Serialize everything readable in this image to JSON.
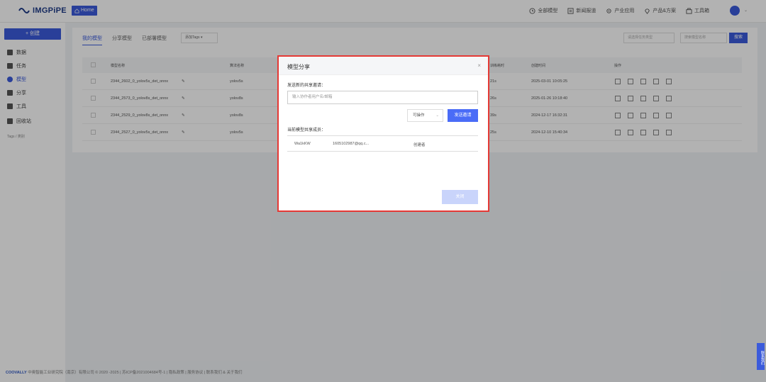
{
  "header": {
    "logo_text": "IMGPiPE",
    "home_label": "Home",
    "nav": [
      {
        "label": "全部模型",
        "icon": "clock-icon"
      },
      {
        "label": "新闻报道",
        "icon": "news-icon"
      },
      {
        "label": "产业应用",
        "icon": "gear-icon"
      },
      {
        "label": "产品&方案",
        "icon": "location-icon"
      },
      {
        "label": "工具箱",
        "icon": "toolbox-icon"
      }
    ]
  },
  "sidebar": {
    "create_label": "+ 创建",
    "items": [
      {
        "label": "数据",
        "active": false
      },
      {
        "label": "任务",
        "active": false
      },
      {
        "label": "模型",
        "active": true
      },
      {
        "label": "分享",
        "active": false
      },
      {
        "label": "工具",
        "active": false
      },
      {
        "label": "回收站",
        "active": false
      }
    ],
    "tags_label": "Tags / 类别"
  },
  "main": {
    "tabs": [
      "我的模型",
      "分享模型",
      "已部署模型"
    ],
    "tag_select": "添加Tags",
    "filter_placeholder": "请选择任务类型",
    "search_placeholder": "搜索模型名称",
    "search_label": "搜索",
    "columns": [
      "模型名称",
      "算法名称",
      "训练耗时",
      "创建时间",
      "操作"
    ],
    "rows": [
      {
        "name": "2344_2602_0_yolov5s_det_onnx",
        "algo": "yolov5s",
        "duration": "21s",
        "created": "2025-03-01 10:05:25"
      },
      {
        "name": "2344_2573_0_yolov8s_det_onnx",
        "algo": "yolov8s",
        "duration": "26s",
        "created": "2025-01-26 10:18:40"
      },
      {
        "name": "2344_2529_0_yolov8s_det_onnx",
        "algo": "yolov8s",
        "duration": "39s",
        "created": "2024-12-17 16:32:31"
      },
      {
        "name": "2344_2527_0_yolov5s_det_onnx",
        "algo": "yolov5s",
        "duration": "25s",
        "created": "2024-12-10 15:40:34"
      }
    ]
  },
  "modal": {
    "title": "模型分享",
    "invite_label": "发送新的共享邀请：",
    "invite_placeholder": "输入协作者用户名/邮箱",
    "permission": "可操作",
    "send_label": "发送邀请",
    "members_label": "当前模型共享成员：",
    "member": {
      "name": "Wa1kKW",
      "email": "1605102987@qq.c...",
      "role": "创建者"
    },
    "close_label": "关闭"
  },
  "footer": {
    "brand": "COOVALLY",
    "text": "中奥智能工业研究院（南京）有限公司 © 2020 -2025 | 苏ICP备2021004684号-1 | 隐私政策 | 服务协议 | 联系我们 & 关于我们"
  },
  "side_tab": "联系我们"
}
